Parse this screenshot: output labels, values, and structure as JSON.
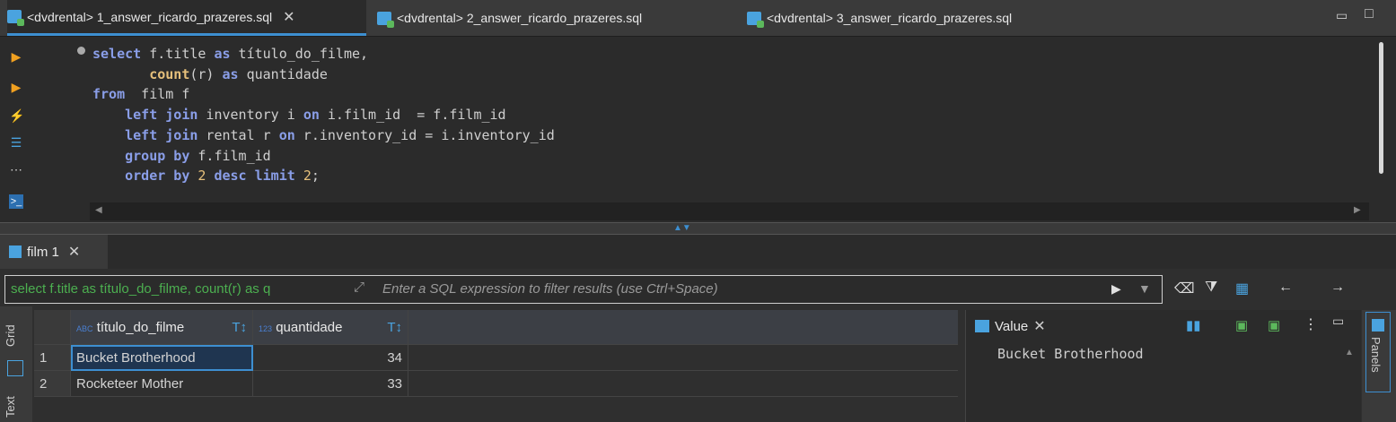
{
  "tabs": [
    {
      "label": "<dvdrental> 1_answer_ricardo_prazeres.sql",
      "active": true,
      "closable": true
    },
    {
      "label": "<dvdrental> 2_answer_ricardo_prazeres.sql",
      "active": false
    },
    {
      "label": "<dvdrental> 3_answer_ricardo_prazeres.sql",
      "active": false
    }
  ],
  "editor": {
    "lines": [
      "select f.title as título_do_filme,",
      "       count(r) as quantidade",
      "from  film f",
      "    left join inventory i on i.film_id  = f.film_id",
      "    left join rental r on r.inventory_id = i.inventory_id",
      "    group by f.film_id",
      "    order by 2 desc limit 2;"
    ]
  },
  "results_tab": {
    "label": "film 1"
  },
  "filter": {
    "query_text": "select f.title as título_do_filme, count(r) as q",
    "placeholder": "Enter a SQL expression to filter results (use Ctrl+Space)"
  },
  "grid": {
    "columns": [
      {
        "label": "título_do_filme",
        "type_icon": "ABC"
      },
      {
        "label": "quantidade",
        "type_icon": "123"
      }
    ],
    "rows": [
      {
        "n": "1",
        "title": "Bucket Brotherhood",
        "qty": "34"
      },
      {
        "n": "2",
        "title": "Rocketeer Mother",
        "qty": "33"
      }
    ],
    "side_tabs": {
      "grid": "Grid",
      "text": "Text"
    }
  },
  "value_panel": {
    "title": "Value",
    "content": "Bucket Brotherhood"
  },
  "right_bar": {
    "panels_label": "Panels"
  },
  "colors": {
    "accent": "#3d8fd1",
    "keyword": "#8a9ee8",
    "function": "#e6c07b",
    "filter_text": "#4caf50"
  }
}
